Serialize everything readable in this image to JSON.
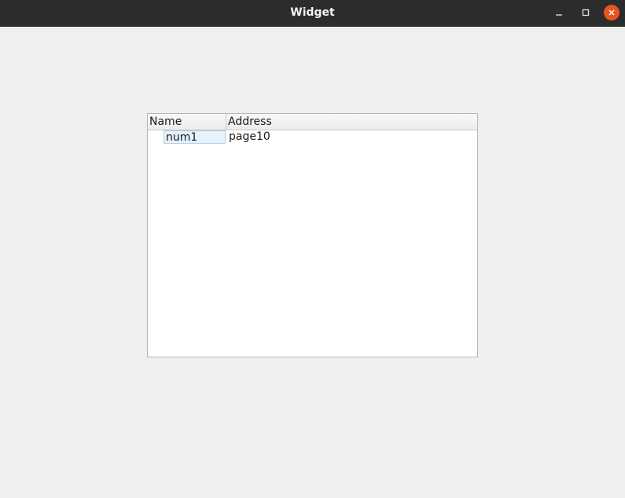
{
  "window": {
    "title": "Widget",
    "controls": {
      "minimize": "minimize-icon",
      "maximize": "maximize-icon",
      "close": "close-icon"
    },
    "close_color": "#e95420"
  },
  "tree": {
    "columns": [
      "Name",
      "Address"
    ],
    "rows": [
      {
        "name": "num1",
        "address": "page10"
      }
    ]
  }
}
